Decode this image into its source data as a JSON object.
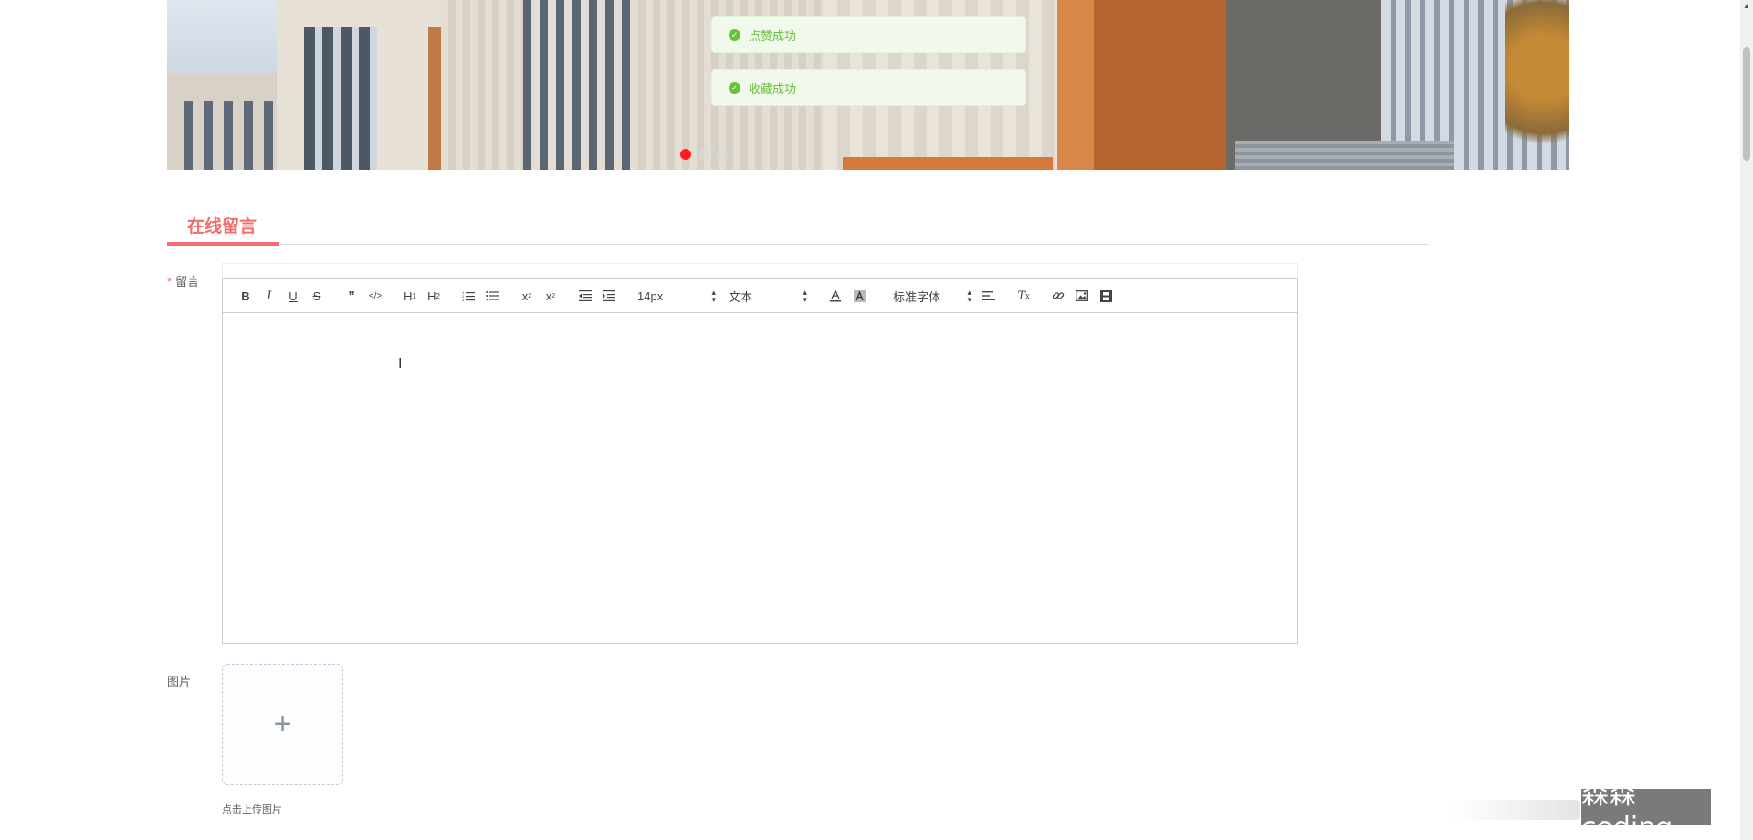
{
  "banner": {
    "image": "school-building-banner",
    "carousel_dots": 3,
    "active_index": 0,
    "active_dot_color": "#ff1f1f"
  },
  "toasts": [
    {
      "text": "点赞成功",
      "type": "success",
      "icon": "check-circle-icon"
    },
    {
      "text": "收藏成功",
      "type": "success",
      "icon": "check-circle-icon"
    }
  ],
  "section": {
    "title": "在线留言",
    "accent_color": "#f56c6c"
  },
  "form": {
    "message": {
      "required_mark": "*",
      "label": "留言",
      "toolbar": {
        "buttons": [
          {
            "name": "bold-button",
            "glyph": "B"
          },
          {
            "name": "italic-button",
            "glyph": "I"
          },
          {
            "name": "underline-button",
            "glyph": "U"
          },
          {
            "name": "strike-button",
            "glyph": "S"
          },
          {
            "name": "blockquote-button",
            "glyph": "99"
          },
          {
            "name": "code-block-button",
            "glyph": "</>"
          },
          {
            "name": "header1-button",
            "glyph": "H1"
          },
          {
            "name": "header2-button",
            "glyph": "H2"
          },
          {
            "name": "ordered-list-button",
            "glyph": "ordered-list-icon"
          },
          {
            "name": "bullet-list-button",
            "glyph": "bullet-list-icon"
          },
          {
            "name": "subscript-button",
            "glyph": "x2"
          },
          {
            "name": "superscript-button",
            "glyph": "x2"
          },
          {
            "name": "outdent-button",
            "glyph": "outdent-icon"
          },
          {
            "name": "indent-button",
            "glyph": "indent-icon"
          }
        ],
        "size_select": "14px",
        "header_select": "文本",
        "font_select": "标准字体"
      }
    },
    "image": {
      "label": "图片",
      "upload_tip": "点击上传图片",
      "plus": "+"
    }
  },
  "watermark": "森森coding"
}
